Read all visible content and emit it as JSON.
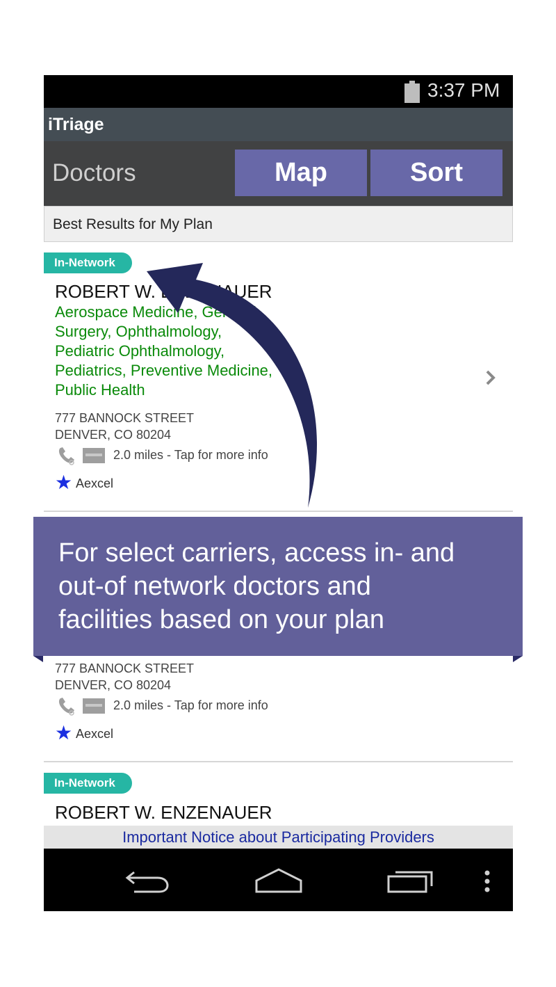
{
  "status_bar": {
    "time": "3:37 PM"
  },
  "app": {
    "title": "iTriage"
  },
  "action_bar": {
    "title": "Doctors",
    "map_label": "Map",
    "sort_label": "Sort"
  },
  "filter": {
    "label": "Best Results for My Plan"
  },
  "results": [
    {
      "badge": "In-Network",
      "name": "ROBERT W. ENZENAUER",
      "specialties_lines": [
        "Aerospace Medicine, General",
        "Surgery, Ophthalmology,",
        "Pediatric Ophthalmology,",
        "Pediatrics, Preventive Medicine,",
        "Public Health"
      ],
      "address_line1": "777 BANNOCK STREET",
      "address_line2": "DENVER, CO 80204",
      "distance": "2.0 miles - Tap for more info",
      "carrier": "Aexcel"
    },
    {
      "address_line1": "777 BANNOCK STREET",
      "address_line2": "DENVER, CO 80204",
      "distance": "2.0 miles - Tap for more info",
      "carrier": "Aexcel"
    },
    {
      "badge": "In-Network",
      "name": "ROBERT W. ENZENAUER"
    }
  ],
  "notice": {
    "label": "Important Notice about Participating Providers"
  },
  "banner": {
    "lines": [
      "For select carriers, access in- and",
      "out-of network doctors and",
      "facilities based on your plan"
    ]
  },
  "colors": {
    "accent": "#6868a8",
    "badge": "#26b6a4",
    "specialty": "#0a8a0a",
    "banner": "#62609a",
    "notice_link": "#1a2aa0"
  },
  "icons": [
    "battery-icon",
    "chevron-right-icon",
    "phone-icon",
    "card-icon",
    "star-icon",
    "back-icon",
    "home-icon",
    "recent-apps-icon",
    "menu-icon",
    "curved-arrow-icon"
  ]
}
